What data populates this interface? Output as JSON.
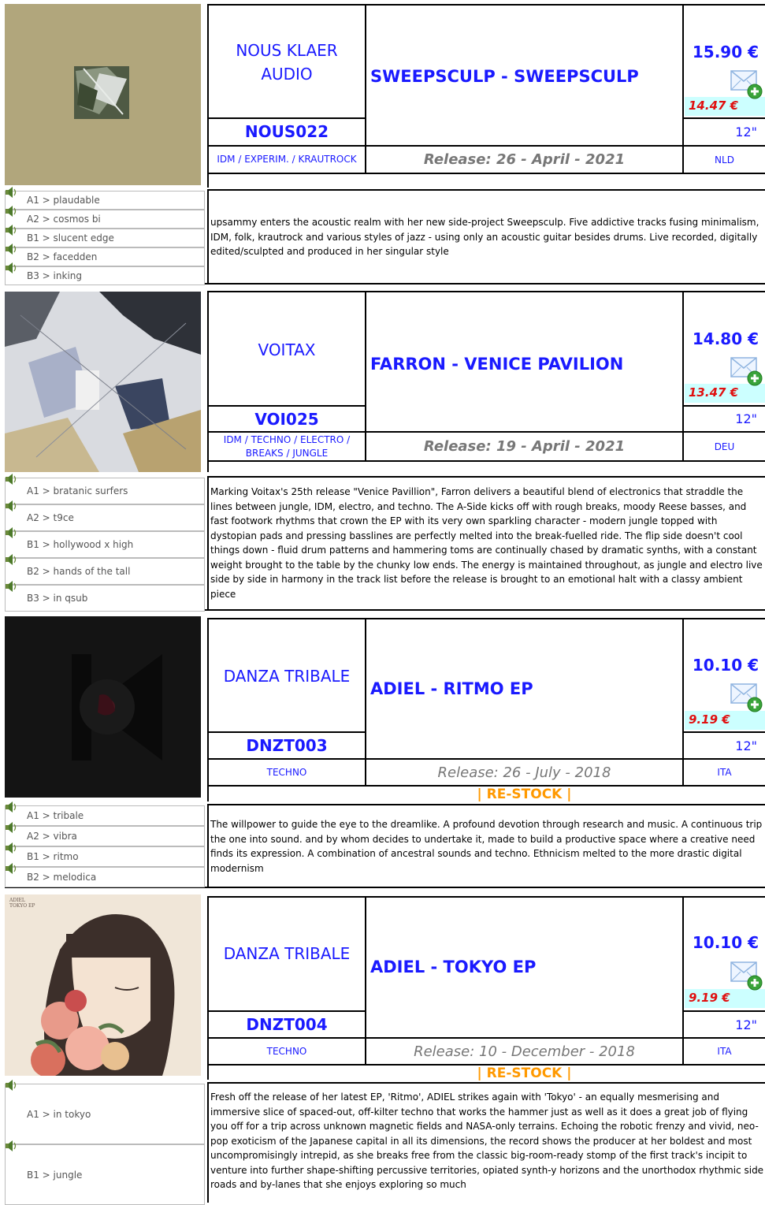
{
  "releases": [
    {
      "label": "NOUS KLAER AUDIO",
      "catalog": "NOUS022",
      "title": "SWEEPSCULP - SWEEPSCULP",
      "genre": "IDM / EXPERIM. / KRAUTROCK",
      "release": "Release: 26 - April - 2021",
      "price": "15.90 €",
      "discount_price": "14.47 €",
      "format": "12\"",
      "country": "NLD",
      "tracks": [
        "A1 > plaudable",
        "A2 > cosmos bi",
        "B1 > slucent edge",
        "B2 > facedden",
        "B3 > inking"
      ],
      "description": "upsammy enters the acoustic realm with her new side-project Sweepsculp. Five addictive tracks fusing minimalism, IDM, folk, krautrock and various styles of jazz - using only an acoustic guitar besides drums. Live recorded, digitally edited/sculpted and produced in her singular style"
    },
    {
      "label": "VOITAX",
      "catalog": "VOI025",
      "title": "FARRON - VENICE PAVILION",
      "genre": "IDM / TECHNO / ELECTRO / BREAKS / JUNGLE",
      "release": "Release: 19 - April - 2021",
      "price": "14.80 €",
      "discount_price": "13.47 €",
      "format": "12\"",
      "country": "DEU",
      "tracks": [
        "A1 > bratanic surfers",
        "A2 > t9ce",
        "B1 > hollywood x high",
        "B2 > hands of the tall",
        "B3 > in qsub"
      ],
      "description": "Marking Voitax's 25th release \"Venice Pavillion\", Farron delivers a beautiful blend of electronics that straddle the lines between jungle, IDM, electro, and techno. The A-Side kicks off with rough breaks, moody Reese basses, and fast footwork rhythms that crown the EP with its very own sparkling character - modern jungle topped with dystopian pads and pressing basslines are perfectly melted into the break-fuelled ride. The flip side doesn't cool things down - fluid drum patterns and hammering toms are continually chased by dramatic synths, with a constant weight brought to the table by the chunky low ends. The energy is maintained throughout, as jungle and electro live side by side in harmony in the track list before the release is brought to an emotional halt with a classy ambient piece"
    },
    {
      "label": "DANZA TRIBALE",
      "catalog": "DNZT003",
      "title": "ADIEL - RITMO EP",
      "genre": "TECHNO",
      "release": "Release: 26 - July - 2018",
      "price": "10.10 €",
      "discount_price": "9.19 €",
      "format": "12\"",
      "country": "ITA",
      "restock": "| RE-STOCK |",
      "tracks": [
        "A1 > tribale",
        "A2 > vibra",
        "B1 > ritmo",
        "B2 > melodica"
      ],
      "description": "The willpower to guide the eye to the dreamlike. A profound devotion through research and music. A continuous trip the one into sound. and by whom decides to undertake it, made to build a productive space where a creative need finds its expression. A combination of ancestral sounds and techno. Ethnicism melted to the more drastic digital modernism"
    },
    {
      "label": "DANZA TRIBALE",
      "catalog": "DNZT004",
      "title": "ADIEL - TOKYO EP",
      "genre": "TECHNO",
      "release": "Release: 10 - December - 2018",
      "price": "10.10 €",
      "discount_price": "9.19 €",
      "format": "12\"",
      "country": "ITA",
      "restock": "| RE-STOCK |",
      "cover_text": "ADIEL\nTOKYO EP",
      "tracks": [
        "A1 > in tokyo",
        "B1 > jungle"
      ],
      "description": "Fresh off the release of her latest EP, 'Ritmo', ADIEL strikes again with 'Tokyo' - an equally mesmerising and immersive slice of spaced-out, off-kilter techno that works the hammer just as well as it does a great job of flying you off for a trip across unknown magnetic fields and NASA-only terrains. Echoing the robotic frenzy and vivid, neo-pop exoticism of the Japanese capital in all its dimensions, the record shows the producer at her boldest and most uncompromisingly intrepid, as she breaks free from the classic big-room-ready stomp of the first track's incipit to venture into further shape-shifting percussive territories, opiated synth-y horizons and the unorthodox rhythmic side roads and by-lanes that she enjoys exploring so much"
    }
  ],
  "colors": {
    "link": "#1a1aff",
    "discount": "#e01010",
    "restock": "#ff9900",
    "discount_bg": "#ccffff"
  }
}
